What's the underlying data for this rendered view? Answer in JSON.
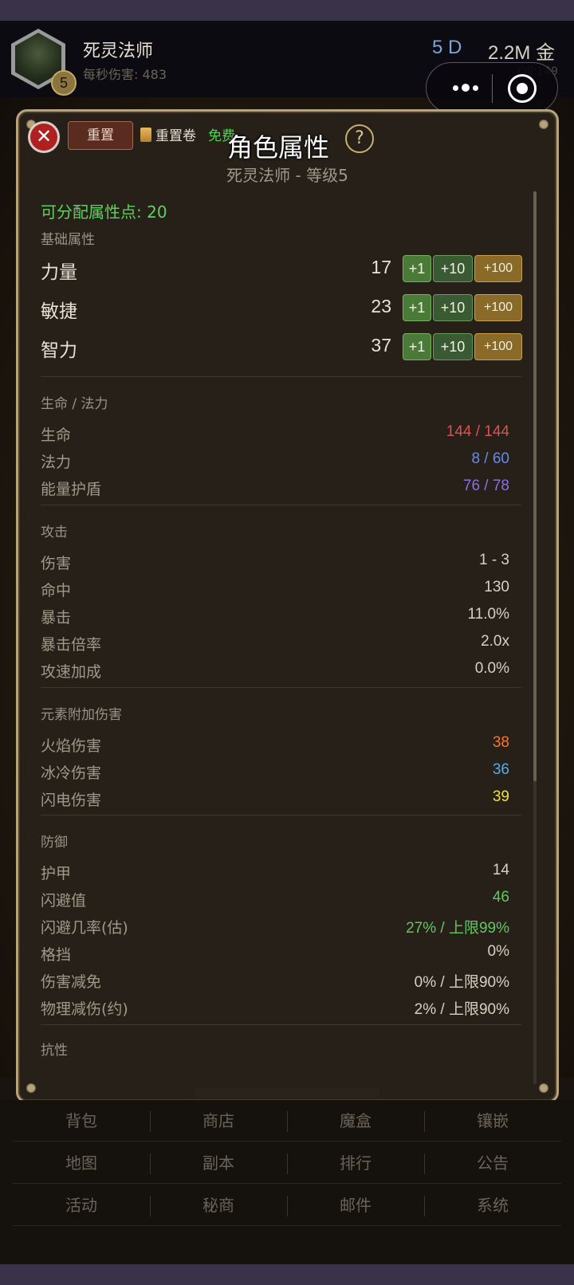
{
  "header": {
    "level": "5",
    "char_name": "死灵法师",
    "dps": "每秒伤害: 483",
    "days": "5 D",
    "gold": "2.2M 金",
    "kill": "Kill:149"
  },
  "panel": {
    "close": "✕",
    "reset": "重置",
    "reset_scroll": "重置卷",
    "free": "免费",
    "title": "角色属性",
    "help": "?",
    "subtitle": "死灵法师 - 等级5",
    "points": "可分配属性点: 20"
  },
  "basic": {
    "label": "基础属性",
    "buttons": {
      "p1": "+1",
      "p10": "+10",
      "p100": "+100"
    },
    "attrs": [
      {
        "name": "力量",
        "value": "17"
      },
      {
        "name": "敏捷",
        "value": "23"
      },
      {
        "name": "智力",
        "value": "37"
      }
    ]
  },
  "life": {
    "label": "生命 / 法力",
    "rows": [
      {
        "name": "生命",
        "value": "144 / 144"
      },
      {
        "name": "法力",
        "value": "8 / 60"
      },
      {
        "name": "能量护盾",
        "value": "76 / 78"
      }
    ]
  },
  "attack": {
    "label": "攻击",
    "rows": [
      {
        "name": "伤害",
        "value": "1 - 3"
      },
      {
        "name": "命中",
        "value": "130"
      },
      {
        "name": "暴击",
        "value": "11.0%"
      },
      {
        "name": "暴击倍率",
        "value": "2.0x"
      },
      {
        "name": "攻速加成",
        "value": "0.0%"
      }
    ]
  },
  "element": {
    "label": "元素附加伤害",
    "rows": [
      {
        "name": "火焰伤害",
        "value": "38"
      },
      {
        "name": "冰冷伤害",
        "value": "36"
      },
      {
        "name": "闪电伤害",
        "value": "39"
      }
    ]
  },
  "defense": {
    "label": "防御",
    "rows": [
      {
        "name": "护甲",
        "value": "14"
      },
      {
        "name": "闪避值",
        "value": "46"
      },
      {
        "name": "闪避几率(估)",
        "value": "27% / 上限99%"
      },
      {
        "name": "格挡",
        "value": "0%"
      },
      {
        "name": "伤害减免",
        "value": "0% / 上限90%"
      },
      {
        "name": "物理减伤(约)",
        "value": "2% / 上限90%"
      }
    ]
  },
  "resist": {
    "label": "抗性"
  },
  "nav": {
    "rows": [
      [
        "背包",
        "商店",
        "魔盒",
        "镶嵌"
      ],
      [
        "地图",
        "副本",
        "排行",
        "公告"
      ],
      [
        "活动",
        "秘商",
        "邮件",
        "系统"
      ]
    ]
  }
}
